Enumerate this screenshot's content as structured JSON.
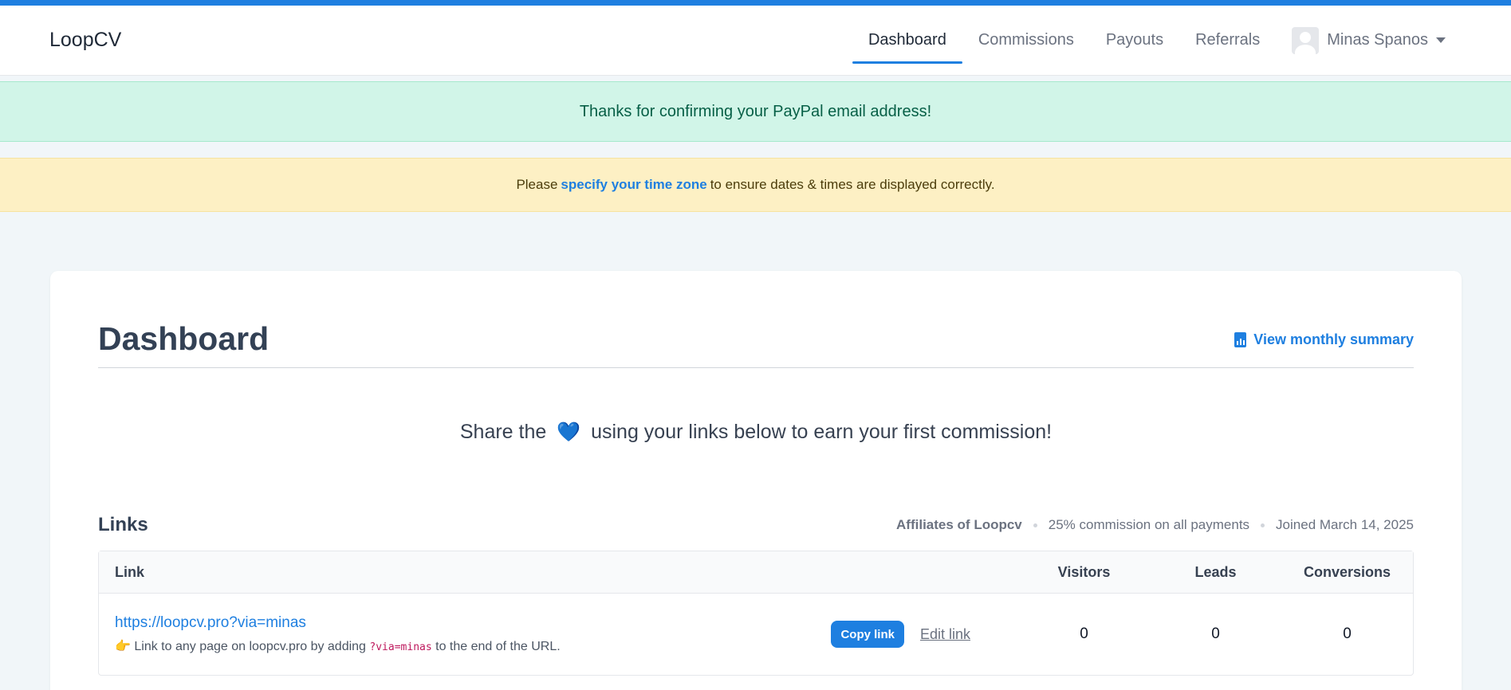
{
  "brand": "LoopCV",
  "nav": {
    "items": [
      {
        "label": "Dashboard",
        "active": true
      },
      {
        "label": "Commissions",
        "active": false
      },
      {
        "label": "Payouts",
        "active": false
      },
      {
        "label": "Referrals",
        "active": false
      }
    ],
    "user_name": "Minas Spanos"
  },
  "alerts": {
    "success": "Thanks for confirming your PayPal email address!",
    "warning": {
      "before": "Please",
      "link": "specify your time zone",
      "after": "to ensure dates & times are displayed correctly."
    }
  },
  "dashboard": {
    "title": "Dashboard",
    "summary_link": "View monthly summary",
    "share": {
      "before": "Share the",
      "heart": "💙",
      "after": "using your links below to earn your first commission!"
    }
  },
  "links_section": {
    "title": "Links",
    "program": "Affiliates of Loopcv",
    "commission": "25% commission on all payments",
    "joined": "Joined March 14, 2025",
    "columns": {
      "link": "Link",
      "visitors": "Visitors",
      "leads": "Leads",
      "conversions": "Conversions"
    },
    "rows": [
      {
        "url": "https://loopcv.pro?via=minas",
        "hint_emoji": "👉",
        "hint_before": "Link to any page on loopcv.pro by adding",
        "hint_code": "?via=minas",
        "hint_after": "to the end of the URL.",
        "copy_label": "Copy link",
        "edit_label": "Edit link",
        "visitors": "0",
        "leads": "0",
        "conversions": "0"
      }
    ]
  },
  "colors": {
    "accent": "#1e7fe0",
    "success_bg": "#d1f5e8",
    "warning_bg": "#fdf0c4"
  }
}
